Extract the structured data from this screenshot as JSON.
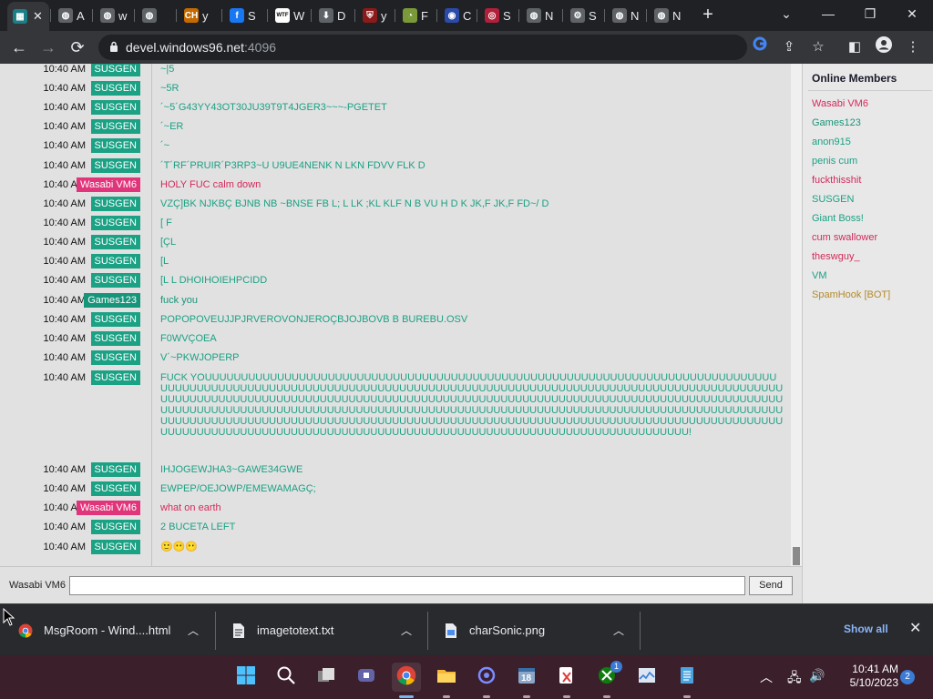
{
  "browser": {
    "tabs": [
      {
        "label": "",
        "icon": "windows96-favicon",
        "color": "#1a7f86",
        "active": true
      },
      {
        "label": "A",
        "icon": "globe-favicon",
        "color": "#5f6368"
      },
      {
        "label": "w",
        "icon": "globe-favicon",
        "color": "#5f6368"
      },
      {
        "label": "",
        "icon": "globe-favicon",
        "color": "#5f6368"
      },
      {
        "label": "y",
        "icon": "ch-favicon",
        "color": "#c46a00"
      },
      {
        "label": "S",
        "icon": "facebook-favicon",
        "color": "#1877f2"
      },
      {
        "label": "W",
        "icon": "wtf-favicon",
        "color": "#ffffff"
      },
      {
        "label": "D",
        "icon": "download-favicon",
        "color": "#5f6368"
      },
      {
        "label": "y",
        "icon": "shield-favicon",
        "color": "#8b1a1a"
      },
      {
        "label": "F",
        "icon": "swirl-favicon",
        "color": "#7a9a3a"
      },
      {
        "label": "C",
        "icon": "dots-favicon",
        "color": "#2a4ba8"
      },
      {
        "label": "S",
        "icon": "target-favicon",
        "color": "#b0203a"
      },
      {
        "label": "N",
        "icon": "chrome-favicon",
        "color": "#5f6368"
      },
      {
        "label": "S",
        "icon": "gear-favicon",
        "color": "#5f6368"
      },
      {
        "label": "N",
        "icon": "globe-favicon",
        "color": "#5f6368"
      },
      {
        "label": "N",
        "icon": "globe-favicon",
        "color": "#5f6368"
      }
    ],
    "url_host": "devel.windows96.net",
    "url_port": ":4096"
  },
  "chat": {
    "messages": [
      {
        "time": "10:40 AM",
        "user": "SUSGEN",
        "user_color": "#1ba184",
        "text_color": "#1ba184",
        "text": "~|5"
      },
      {
        "time": "10:40 AM",
        "user": "SUSGEN",
        "user_color": "#1ba184",
        "text_color": "#1ba184",
        "text": "~5R"
      },
      {
        "time": "10:40 AM",
        "user": "SUSGEN",
        "user_color": "#1ba184",
        "text_color": "#1ba184",
        "text": "´~5´G43YY43OT30JU39T9T4JGER3~~~-PGETET"
      },
      {
        "time": "10:40 AM",
        "user": "SUSGEN",
        "user_color": "#1ba184",
        "text_color": "#1ba184",
        "text": "´~ER"
      },
      {
        "time": "10:40 AM",
        "user": "SUSGEN",
        "user_color": "#1ba184",
        "text_color": "#1ba184",
        "text": "´~"
      },
      {
        "time": "10:40 AM",
        "user": "SUSGEN",
        "user_color": "#1ba184",
        "text_color": "#1ba184",
        "text": "´T´RF´PRUIR´P3RP3~U U9UE4NENK N LKN FDVV FLK D"
      },
      {
        "time": "10:40 AM",
        "user": "Wasabi VM6",
        "user_color": "#e0357a",
        "text_color": "#d42a5a",
        "text": "HOLY FUC calm down"
      },
      {
        "time": "10:40 AM",
        "user": "SUSGEN",
        "user_color": "#1ba184",
        "text_color": "#1ba184",
        "text": "VZÇ]BK NJKBÇ BJNB NB  ~BNSE FB L; L LK ;KL KLF N B VU H     D K  JK,F JK,F FD~/ D"
      },
      {
        "time": "10:40 AM",
        "user": "SUSGEN",
        "user_color": "#1ba184",
        "text_color": "#1ba184",
        "text": "[ F"
      },
      {
        "time": "10:40 AM",
        "user": "SUSGEN",
        "user_color": "#1ba184",
        "text_color": "#1ba184",
        "text": "[ÇL"
      },
      {
        "time": "10:40 AM",
        "user": "SUSGEN",
        "user_color": "#1ba184",
        "text_color": "#1ba184",
        "text": "[L"
      },
      {
        "time": "10:40 AM",
        "user": "SUSGEN",
        "user_color": "#1ba184",
        "text_color": "#1ba184",
        "text": "[L L DHOIHOIEHPCIDD"
      },
      {
        "time": "10:40 AM",
        "user": "Games123",
        "user_color": "#17957a",
        "text_color": "#17957a",
        "text": "fuck you"
      },
      {
        "time": "10:40 AM",
        "user": "SUSGEN",
        "user_color": "#1ba184",
        "text_color": "#1ba184",
        "text": "POPOPOVEUJJPJRVEROVONJEROÇBJOJBOVB B BUREBU.OSV"
      },
      {
        "time": "10:40 AM",
        "user": "SUSGEN",
        "user_color": "#1ba184",
        "text_color": "#1ba184",
        "text": "F0WVÇOEA"
      },
      {
        "time": "10:40 AM",
        "user": "SUSGEN",
        "user_color": "#1ba184",
        "text_color": "#1ba184",
        "text": "V´~PKWJOPERP"
      },
      {
        "time": "10:40 AM",
        "user": "SUSGEN",
        "user_color": "#1ba184",
        "text_color": "#1ba184",
        "text": "FUCK YOUUUUUUUUUUUUUUUUUUUUUUUUUUUUUUUUUUUUUUUUUUUUUUUUUUUUUUUUUUUUUUUUUUUUUUUUUUUUUUUUUUUUUUUUUUUUUUUUUUUUUUUUUUUUUUUUUUUUUUUUUUUUUUUUUUUUUUUUUUUUUUUUUUUUUUUUUUUUUUUUUUUUUUUUUUUUUUUUUUUUUUUUUUUUUUUUUUUUUUUUUUUUUUUUUUUUUUUUUUUUUUUUUUUUUUUUUUUUUUUUUUUUUUUUUUUUUUUUUUUUUUUUUUUUUUUUUUUUUUUUUUUUUUUUUUUUUUUUUUUUUUUUUUUUUUUUUUUUUUUUUUUUUUUUUUUUUUUUUUUUUUUUUUUUUUUUUUUUUUUUUUUUUUUUUUUUUUUUUUUUUUUUUUUUUUUUUUUUUUUUUUUUUUUUUUUUUUUUUUUUUUUUUUUUUUUUUUUUUUUUUUUUUUUUUUUUUUUUUUUUUUUUUUUUUUUUUUUUUUUUUUUUUUUUUUUUUUUU!"
      },
      {
        "time": "10:40 AM",
        "user": "SUSGEN",
        "user_color": "#1ba184",
        "text_color": "#1ba184",
        "text": "IHJOGEWJHA3~GAWE34GWE"
      },
      {
        "time": "10:40 AM",
        "user": "SUSGEN",
        "user_color": "#1ba184",
        "text_color": "#1ba184",
        "text": "EWPEP/OEJOWP/EMEWAMAGÇ;"
      },
      {
        "time": "10:40 AM",
        "user": "Wasabi VM6",
        "user_color": "#e0357a",
        "text_color": "#d42a5a",
        "text": "what on earth"
      },
      {
        "time": "10:40 AM",
        "user": "SUSGEN",
        "user_color": "#1ba184",
        "text_color": "#1ba184",
        "text": "2 BUCETA LEFT"
      },
      {
        "time": "10:40 AM",
        "user": "SUSGEN",
        "user_color": "#1ba184",
        "text_color": "#1ba184",
        "text": "🙂😶😶"
      }
    ],
    "current_user": "Wasabi VM6",
    "input_value": "",
    "send_label": "Send"
  },
  "members": {
    "title": "Online Members",
    "list": [
      {
        "name": "Wasabi VM6",
        "color": "#d42a5a"
      },
      {
        "name": "Games123",
        "color": "#17957a"
      },
      {
        "name": "anon915",
        "color": "#1ba184"
      },
      {
        "name": "penis cum",
        "color": "#1ba184"
      },
      {
        "name": "fuckthisshit",
        "color": "#d42a5a"
      },
      {
        "name": "SUSGEN",
        "color": "#1ba184"
      },
      {
        "name": "Giant Boss!",
        "color": "#1ba184"
      },
      {
        "name": "cum swallower",
        "color": "#d42a5a"
      },
      {
        "name": "theswguy_",
        "color": "#d42a5a"
      },
      {
        "name": "VM",
        "color": "#1ba184"
      },
      {
        "name": "SpamHook [BOT]",
        "color": "#b38a2a"
      }
    ]
  },
  "downloads": {
    "items": [
      {
        "name": "MsgRoom - Wind....html",
        "icon": "chrome-icon"
      },
      {
        "name": "imagetotext.txt",
        "icon": "text-file-icon"
      },
      {
        "name": "charSonic.png",
        "icon": "image-file-icon"
      }
    ],
    "show_all": "Show all"
  },
  "taskbar": {
    "time": "10:41 AM",
    "date": "5/10/2023",
    "notifications": "2",
    "apps": [
      "windows-start-icon",
      "search-icon",
      "task-view-icon",
      "meet-icon",
      "chrome-icon",
      "file-explorer-icon",
      "mail-icon",
      "calendar-icon",
      "snipping-tool-icon",
      "xbox-icon",
      "task-manager-icon",
      "notepad-icon"
    ],
    "xbox_badge": "1",
    "calendar_day": "18"
  }
}
